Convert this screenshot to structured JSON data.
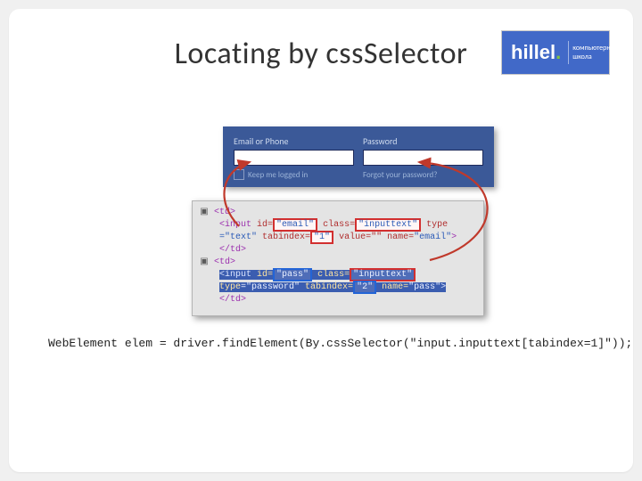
{
  "title": "Locating by cssSelector",
  "logo": {
    "brand": "hillel",
    "sub1": "компьютерная",
    "sub2": "школа"
  },
  "fb": {
    "emailLabel": "Email or Phone",
    "passLabel": "Password",
    "keep": "Keep me logged in",
    "forgot": "Forgot your password?"
  },
  "insp": {
    "td_open": "<td>",
    "td_close": "</td>",
    "input": "<input",
    "id_attr": "id=",
    "class_attr": "class=",
    "type_attr": "type",
    "eq_text": "=\"text\"",
    "tabindex_attr": "tabindex=",
    "value_attr": "value=\"\"",
    "name_attr": "name=",
    "id_email": "\"email\"",
    "class_val": "\"inputtext\"",
    "tab1": "\"1\"",
    "name_email": "\"email\"",
    "id_pass": "\"pass\"",
    "eq_pw": "=\"password\"",
    "tab2": "\"2\"",
    "name_pass": "\"pass\"",
    "close": ">"
  },
  "code": "WebElement elem = driver.findElement(By.cssSelector(\"input.inputtext[tabindex=1]\"));"
}
